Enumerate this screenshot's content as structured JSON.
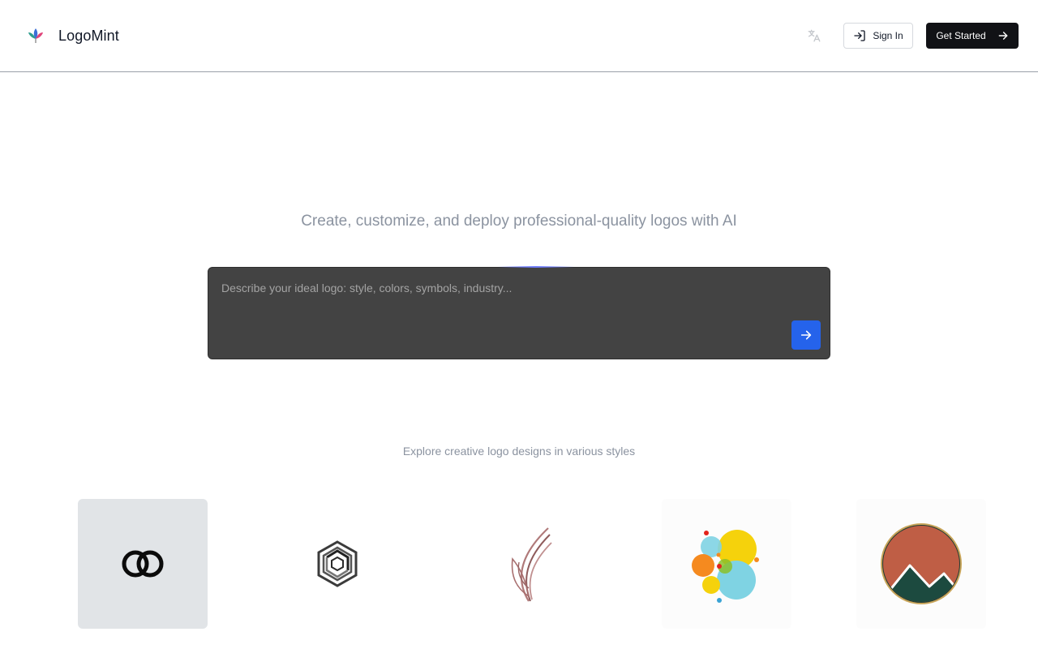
{
  "brand": {
    "name": "LogoMint",
    "logo_icon": "lotus-leaf-logo"
  },
  "header": {
    "translate_icon": "translate-icon",
    "sign_in_label": "Sign In",
    "sign_in_icon": "login-arrow-icon",
    "get_started_label": "Get Started",
    "get_started_icon": "arrow-right-icon"
  },
  "hero": {
    "tagline": "Create, customize, and deploy professional-quality logos with AI",
    "prompt_placeholder": "Describe your ideal logo: style, colors, symbols, industry...",
    "prompt_value": "",
    "submit_icon": "arrow-right-icon"
  },
  "gallery": {
    "heading": "Explore creative logo designs in various styles",
    "items": [
      {
        "icon": "interlocking-rings-logo"
      },
      {
        "icon": "hexagon-cube-logo"
      },
      {
        "icon": "feather-leaf-logo"
      },
      {
        "icon": "colorful-bubbles-logo"
      },
      {
        "icon": "mountain-circle-logo"
      }
    ]
  },
  "colors": {
    "accent": "#2563eb",
    "dark_button": "#111216",
    "prompt_bg": "#434343",
    "muted_text": "#8b93a0"
  }
}
